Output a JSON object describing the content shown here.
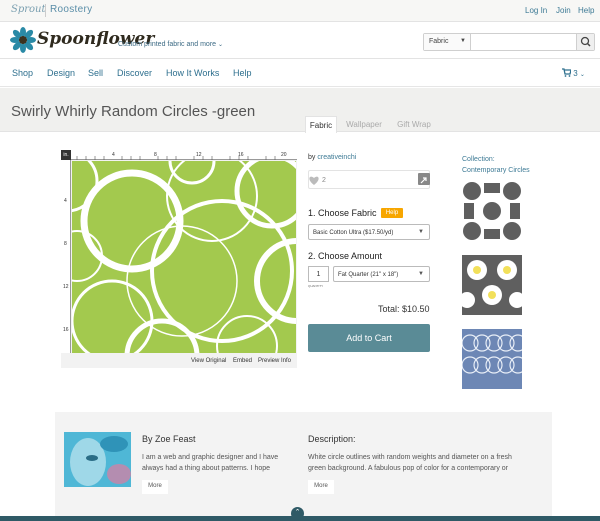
{
  "topbar": {
    "brand_sprout": "Sprout",
    "brand_roostery": "Roostery",
    "login": "Log In",
    "join": "Join",
    "help": "Help"
  },
  "header": {
    "logo_text": "Spoonflower",
    "tagline": "Custom printed fabric and more",
    "search_category": "Fabric",
    "search_placeholder": ""
  },
  "nav": {
    "items": [
      "Shop",
      "Design",
      "Sell",
      "Discover",
      "How It Works",
      "Help"
    ],
    "cart_count": "3"
  },
  "product": {
    "title": "Swirly Whirly Random Circles -green",
    "tabs": [
      "Fabric",
      "Wallpaper",
      "Gift Wrap"
    ],
    "active_tab": "Fabric",
    "by_prefix": "by",
    "designer_handle": "creativeinchi",
    "fav_count": "2",
    "step1": "1. Choose Fabric",
    "help_label": "Help",
    "fabric_option": "Basic Cotton Ultra ($17.50/yd)",
    "step2": "2. Choose Amount",
    "quantity": "1",
    "quantity_label": "QUANTITY",
    "amount_option": "Fat Quarter (21\" x 18\")",
    "total": "Total: $10.50",
    "add_to_cart": "Add to Cart"
  },
  "preview": {
    "unit_badge": "in.",
    "ruler_top": [
      "4",
      "8",
      "12",
      "16",
      "20"
    ],
    "ruler_left": [
      "4",
      "8",
      "12",
      "16"
    ],
    "links": [
      "View Original",
      "Embed",
      "Preview Info"
    ],
    "fabric_color": "#a3c94e"
  },
  "collection": {
    "label": "Collection:",
    "name": "Contemporary Circles"
  },
  "designer": {
    "name": "By Zoe Feast",
    "bio": "I am a web and graphic designer and I have always had a thing about patterns. I hope",
    "more": "More"
  },
  "description": {
    "heading": "Description:",
    "text": "White circle outlines with random weights and diameter on a fresh green background. A fabulous pop of color for a contemporary or",
    "more": "More"
  },
  "colors": {
    "accent": "#3d7a95",
    "cart_button": "#5a8b96",
    "help_badge": "#f7a600",
    "footer": "#2f5a66"
  }
}
